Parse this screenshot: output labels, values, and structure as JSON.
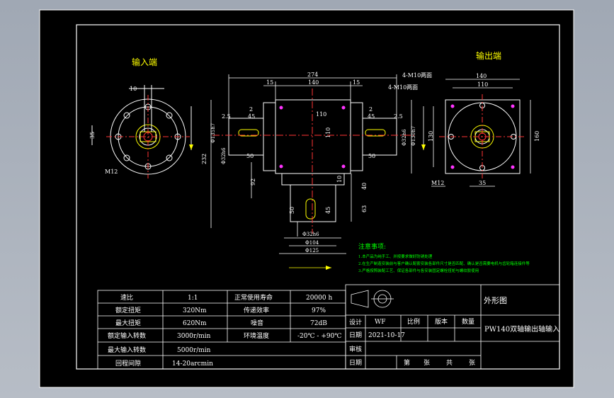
{
  "titles": {
    "input_end": "输入端",
    "output_end": "输出端"
  },
  "notes": {
    "heading": "注意事项:",
    "items": [
      "1.本产品为纯手工、并按要求做好防锈处理",
      "2.在生产制造安装前与客户确认配套安装各部件尺寸是否匹配、确认是否需要电机与齿轮箱连接件等",
      "3.严格按照装配工艺、保证各部件与各安装固定螺栓扭矩与螺纹胶使用"
    ]
  },
  "dims": {
    "total_width": "274",
    "front_140": "140",
    "left_15": "15",
    "right_15": "15",
    "tap_top": "4-M10两面",
    "tap_right": "4-M10两面",
    "center_110": "110",
    "vert_110": "110",
    "key_2_left": "2",
    "key_45_left": "45",
    "key_2_5_left": "2.5",
    "key_2_right": "2",
    "key_45_right": "45",
    "key_2_5_right": "2.5",
    "key_50_left": "50",
    "key_50_right": "50",
    "shaft_left": "Φ135h7",
    "shaft_left2": "Φ32h6",
    "shaft_right": "Φ32h6",
    "shaft_right2": "Φ130h7",
    "height_232": "232",
    "d_92": "92",
    "d_10": "10",
    "d_40": "40",
    "d_63": "63",
    "bot_50": "50",
    "bot_45": "45",
    "bot_shaft": "Φ32h6",
    "bot_104": "Φ104",
    "bot_125": "Φ125",
    "left_10": "10",
    "left_35": "35",
    "left_m12": "M12",
    "right_140": "140",
    "right_110": "110",
    "right_130": "130",
    "right_160": "160",
    "right_m12": "M12",
    "right_35": "35"
  },
  "spec_table": {
    "rows": [
      {
        "k1": "速比",
        "v1": "1:1",
        "k2": "正常使用寿命",
        "v2": "20000 h"
      },
      {
        "k1": "额定扭矩",
        "v1": "320Nm",
        "k2": "传递效率",
        "v2": "97%"
      },
      {
        "k1": "最大扭矩",
        "v1": "620Nm",
        "k2": "噪音",
        "v2": "72dB"
      },
      {
        "k1": "额定输入转数",
        "v1": "3000r/min",
        "k2": "环境温度",
        "v2": "-20℃ - +90℃"
      },
      {
        "k1": "最大输入转数",
        "v1": "5000r/min",
        "k2": "",
        "v2": ""
      },
      {
        "k1": "回程间隙",
        "v1": "14-20arcmin",
        "k2": "",
        "v2": ""
      }
    ]
  },
  "title_block": {
    "drawing_type": "外形图",
    "product_name": "PW140双轴输出轴输入",
    "design_label": "设计",
    "design_value": "WF",
    "scale_label": "比例",
    "version_label": "版本",
    "qty_label": "数量",
    "date_label": "日期",
    "date_value": "2021-10-17",
    "review_label": "审核",
    "date2_label": "日期",
    "sheet_label": "第",
    "sheet_of": "张",
    "total_label": "共",
    "total_of": "张"
  }
}
